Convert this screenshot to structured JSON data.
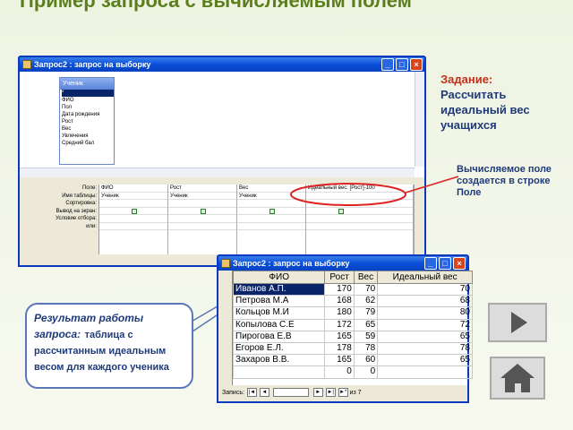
{
  "slide": {
    "title": "Пример  запроса с вычисляемым полем",
    "task_label": "Задание:",
    "task_text": "Рассчитать идеальный вес учащихся",
    "calc_note": "Вычисляемое поле создается в строке Поле",
    "result_label": "Результат работы запроса:",
    "result_text": "таблица с рассчитанным идеальным весом для каждого ученика",
    "next_icon": "play-icon",
    "home_icon": "home-icon"
  },
  "design_window": {
    "title": "Запрос2 : запрос на выборку",
    "table_title": "Ученик",
    "fields": [
      "*",
      "ФИО",
      "Пол",
      "Дата рождения",
      "Рост",
      "Вес",
      "Увлечения",
      "Средний бал"
    ],
    "row_labels": [
      "Поле:",
      "Имя таблицы:",
      "Сортировка:",
      "Вывод на экран:",
      "Условие отбора:",
      "или:"
    ],
    "columns": [
      {
        "field": "ФИО",
        "table": "Ученик",
        "show": true
      },
      {
        "field": "Рост",
        "table": "Ученик",
        "show": true
      },
      {
        "field": "Вес",
        "table": "Ученик",
        "show": true
      },
      {
        "field": "Идеальный вес: [Рост]-100",
        "table": "",
        "show": true
      }
    ]
  },
  "result_window": {
    "title": "Запрос2 : запрос на выборку",
    "headers": [
      "ФИО",
      "Рост",
      "Вес",
      "Идеальный вес"
    ],
    "rows": [
      [
        "Иванов А.П.",
        "170",
        "70",
        "70"
      ],
      [
        "Петрова М.А",
        "168",
        "62",
        "68"
      ],
      [
        "Кольцов М.И",
        "180",
        "79",
        "80"
      ],
      [
        "Копылова С.Е",
        "172",
        "65",
        "72"
      ],
      [
        "Пирогова Е.В",
        "165",
        "59",
        "65"
      ],
      [
        "Егоров Е.Л.",
        "178",
        "78",
        "78"
      ],
      [
        "Захаров В.В.",
        "165",
        "60",
        "65"
      ],
      [
        "",
        "0",
        "0",
        ""
      ]
    ],
    "nav_label": "Запись:",
    "nav_total": "из  7"
  }
}
